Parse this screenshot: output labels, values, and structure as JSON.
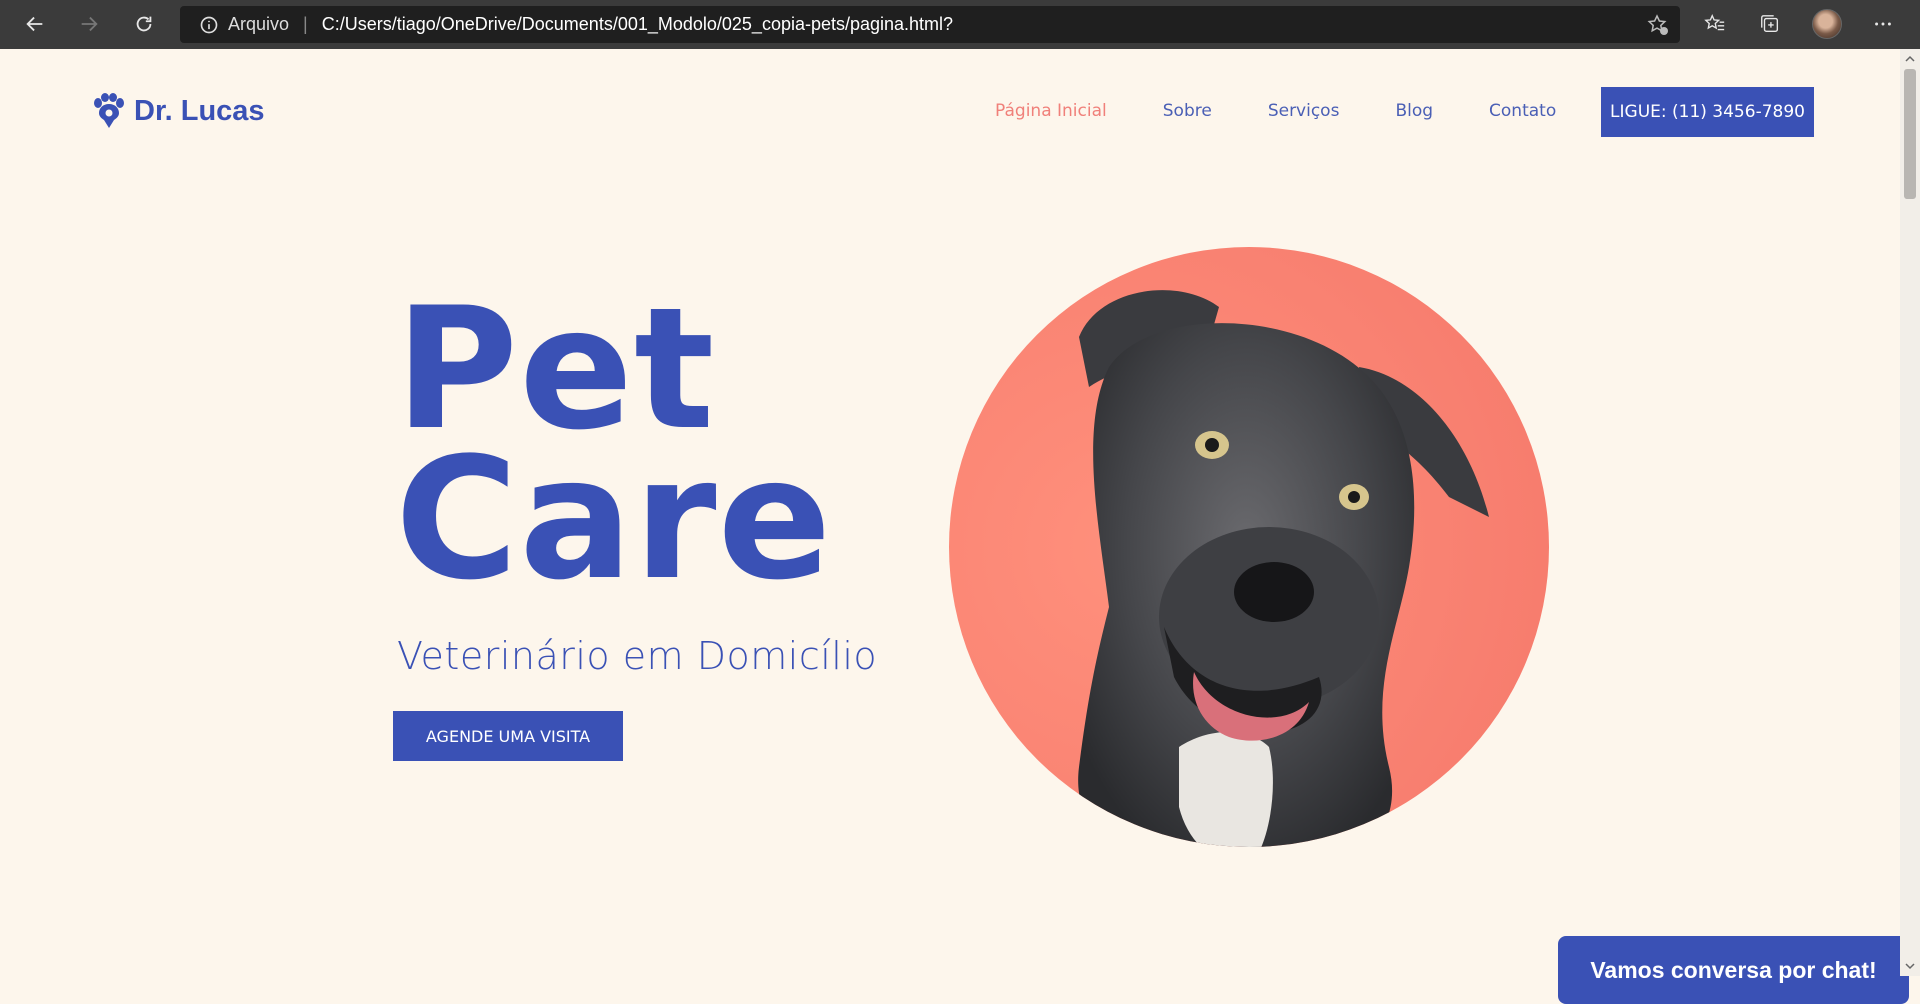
{
  "browser": {
    "protocol_label": "Arquivo",
    "url": "C:/Users/tiago/OneDrive/Documents/001_Modolo/025_copia-pets/pagina.html?"
  },
  "header": {
    "brand": "Dr. Lucas",
    "nav": [
      "Página Inicial",
      "Sobre",
      "Serviços",
      "Blog",
      "Contato"
    ],
    "call_button": "LIGUE: (11) 3456-7890"
  },
  "hero": {
    "title_line1": "Pet",
    "title_line2": "Care",
    "subtitle": "Veterinário em Domicílio",
    "cta": "AGENDE UMA VISITA"
  },
  "chat_button": "Vamos conversa por chat!",
  "colors": {
    "brand_blue": "#3a51b5",
    "accent_coral": "#f98272",
    "background": "#fdf6ec"
  }
}
